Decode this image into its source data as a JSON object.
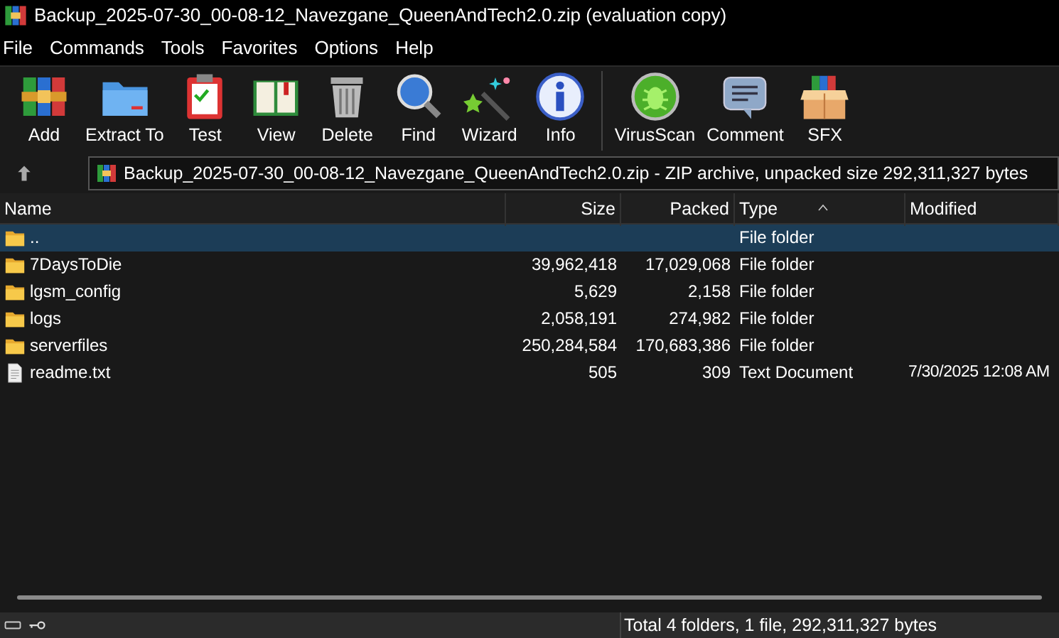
{
  "window": {
    "title": "Backup_2025-07-30_00-08-12_Navezgane_QueenAndTech2.0.zip (evaluation copy)"
  },
  "menu": [
    "File",
    "Commands",
    "Tools",
    "Favorites",
    "Options",
    "Help"
  ],
  "toolbar": [
    {
      "label": "Add"
    },
    {
      "label": "Extract To"
    },
    {
      "label": "Test"
    },
    {
      "label": "View"
    },
    {
      "label": "Delete"
    },
    {
      "label": "Find"
    },
    {
      "label": "Wizard"
    },
    {
      "label": "Info"
    },
    {
      "label": "VirusScan",
      "separator_before": true
    },
    {
      "label": "Comment"
    },
    {
      "label": "SFX"
    }
  ],
  "address": {
    "text": "Backup_2025-07-30_00-08-12_Navezgane_QueenAndTech2.0.zip - ZIP archive, unpacked size 292,311,327 bytes"
  },
  "table": {
    "columns": [
      "Name",
      "Size",
      "Packed",
      "Type",
      "Modified"
    ],
    "rows": [
      {
        "kind": "folder",
        "name": "..",
        "size": "",
        "packed": "",
        "type": "File folder",
        "modified": "",
        "selected": true
      },
      {
        "kind": "folder",
        "name": "7DaysToDie",
        "size": "39,962,418",
        "packed": "17,029,068",
        "type": "File folder",
        "modified": "",
        "selected": false
      },
      {
        "kind": "folder",
        "name": "lgsm_config",
        "size": "5,629",
        "packed": "2,158",
        "type": "File folder",
        "modified": "",
        "selected": false
      },
      {
        "kind": "folder",
        "name": "logs",
        "size": "2,058,191",
        "packed": "274,982",
        "type": "File folder",
        "modified": "",
        "selected": false
      },
      {
        "kind": "folder",
        "name": "serverfiles",
        "size": "250,284,584",
        "packed": "170,683,386",
        "type": "File folder",
        "modified": "",
        "selected": false
      },
      {
        "kind": "file",
        "name": "readme.txt",
        "size": "505",
        "packed": "309",
        "type": "Text Document",
        "modified": "7/30/2025 12:08 AM",
        "selected": false
      }
    ]
  },
  "status_bar": {
    "text": "Total 4 folders, 1 file, 292,311,327 bytes"
  }
}
